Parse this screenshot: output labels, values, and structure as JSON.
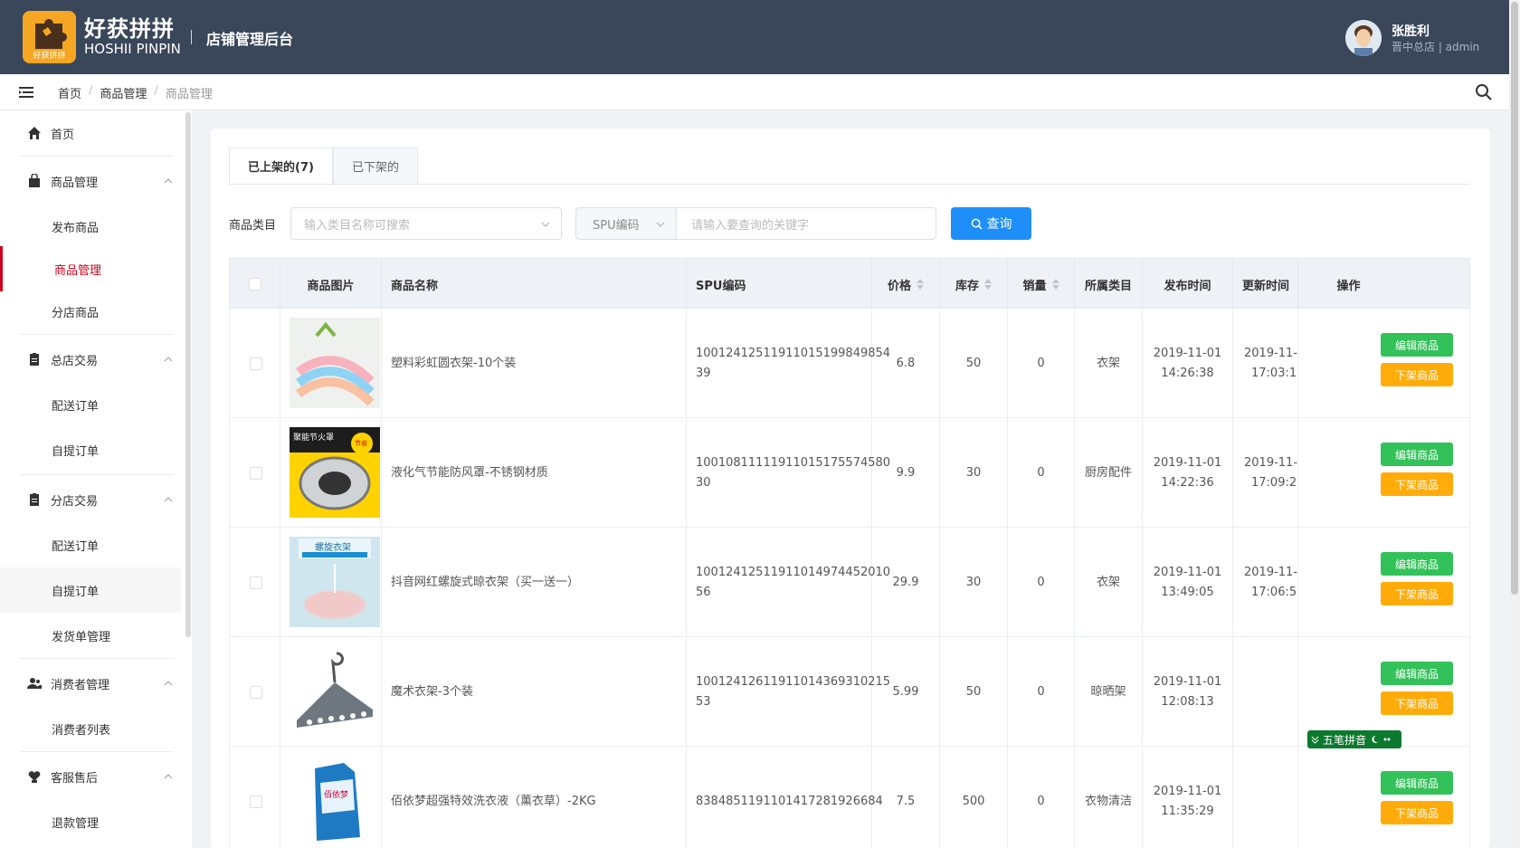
{
  "header": {
    "logo_caption": "好获拼拼",
    "brand_cn": "好获拼拼",
    "brand_en": "HOSHII PINPIN",
    "title": "店铺管理后台",
    "user_name": "张胜利",
    "user_role": "晋中总店 | admin"
  },
  "breadcrumb": [
    "首页",
    "商品管理",
    "商品管理"
  ],
  "sidebar": {
    "items": [
      {
        "label": "首页"
      },
      {
        "label": "商品管理"
      },
      {
        "label": "发布商品"
      },
      {
        "label": "商品管理"
      },
      {
        "label": "分店商品"
      },
      {
        "label": "总店交易"
      },
      {
        "label": "配送订单"
      },
      {
        "label": "自提订单"
      },
      {
        "label": "分店交易"
      },
      {
        "label": "配送订单"
      },
      {
        "label": "自提订单"
      },
      {
        "label": "发货单管理"
      },
      {
        "label": "消费者管理"
      },
      {
        "label": "消费者列表"
      },
      {
        "label": "客服售后"
      },
      {
        "label": "退款管理"
      }
    ]
  },
  "tabs": [
    "已上架的(7)",
    "已下架的"
  ],
  "filter": {
    "category_label": "商品类目",
    "category_placeholder": "输入类目名称可搜索",
    "spu_select": "SPU编码",
    "keyword_placeholder": "请输入要查询的关键字",
    "query_button": "查询"
  },
  "table": {
    "headers": [
      "商品图片",
      "商品名称",
      "SPU编码",
      "价格",
      "库存",
      "销量",
      "所属类目",
      "发布时间",
      "更新时间",
      "操作"
    ],
    "rows": [
      {
        "name": "塑料彩虹圆衣架-10个装",
        "spu1": "10012412511911015199849854",
        "spu2": "39",
        "price": "6.8",
        "stock": "50",
        "sales": "0",
        "category": "衣架",
        "pub_date": "2019-11-01",
        "pub_time": "14:26:38",
        "upd_date": "2019-11-",
        "upd_time": "17:03:1"
      },
      {
        "name": "液化气节能防风罩-不锈钢材质",
        "spu1": "10010811111911015175574580",
        "spu2": "30",
        "price": "9.9",
        "stock": "30",
        "sales": "0",
        "category": "厨房配件",
        "pub_date": "2019-11-01",
        "pub_time": "14:22:36",
        "upd_date": "2019-11-",
        "upd_time": "17:09:2"
      },
      {
        "name": "抖音网红螺旋式晾衣架（买一送一）",
        "spu1": "10012412511911014974452010",
        "spu2": "56",
        "price": "29.9",
        "stock": "30",
        "sales": "0",
        "category": "衣架",
        "pub_date": "2019-11-01",
        "pub_time": "13:49:05",
        "upd_date": "2019-11-",
        "upd_time": "17:06:5"
      },
      {
        "name": "魔术衣架-3个装",
        "spu1": "10012412611911014369310215",
        "spu2": "53",
        "price": "5.99",
        "stock": "50",
        "sales": "0",
        "category": "晾晒架",
        "pub_date": "2019-11-01",
        "pub_time": "12:08:13",
        "upd_date": "",
        "upd_time": ""
      },
      {
        "name": "佰依梦超强特效洗衣液（薰衣草）-2KG",
        "spu1": "8384851191101417281926684",
        "spu2": "",
        "price": "7.5",
        "stock": "500",
        "sales": "0",
        "category": "衣物清洁",
        "pub_date": "2019-11-01",
        "pub_time": "11:35:29",
        "upd_date": "",
        "upd_time": ""
      }
    ],
    "edit_label": "编辑商品",
    "down_label": "下架商品"
  },
  "image_thumbs": {
    "row2_badge": "聚能节火罩",
    "row2_save": "节省",
    "row3_title": "螺旋衣架",
    "row5_brand": "佰依梦"
  },
  "ime_label": "五笔拼音",
  "colors": {
    "header": "#3a475a",
    "primary": "#1e8ef9",
    "edit": "#33c15a",
    "down": "#ffac0a",
    "active": "#d0021b"
  }
}
